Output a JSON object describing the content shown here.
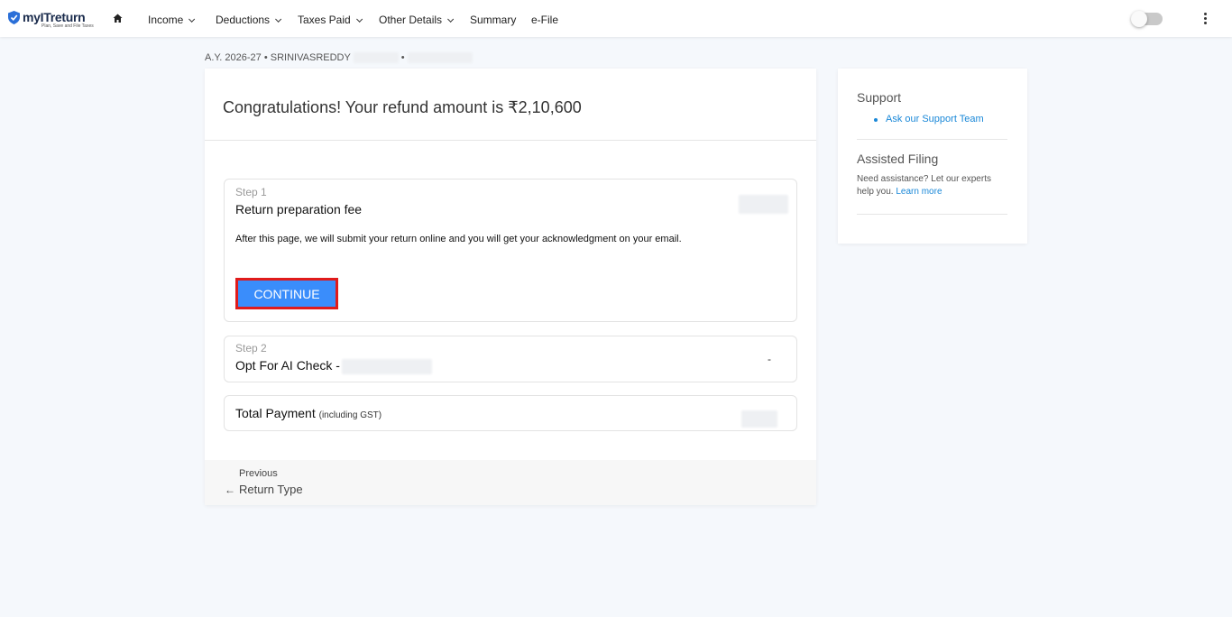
{
  "brand": {
    "name": "myITreturn",
    "tagline": "Plan, Save and File Taxes"
  },
  "nav": {
    "items": [
      {
        "label": "Income",
        "has_dropdown": true
      },
      {
        "label": "Deductions",
        "has_dropdown": true
      },
      {
        "label": "Taxes Paid",
        "has_dropdown": true
      },
      {
        "label": "Other Details",
        "has_dropdown": true
      },
      {
        "label": "Summary",
        "has_dropdown": false
      },
      {
        "label": "e-File",
        "has_dropdown": false
      }
    ],
    "toggle_on": false
  },
  "breadcrumb": {
    "assessment_year": "A.Y. 2026-27",
    "separator": "•",
    "name": "SRINIVASREDDY",
    "separator2": "•"
  },
  "main": {
    "heading": "Congratulations! Your refund amount is ₹2,10,600",
    "step1": {
      "label": "Step 1",
      "title": "Return preparation fee",
      "note": "After this page, we will submit your return online and you will get your acknowledgment on your email.",
      "button": "CONTINUE"
    },
    "step2": {
      "label": "Step 2",
      "title": "Opt For AI Check -",
      "value": "-"
    },
    "total": {
      "label": "Total Payment",
      "suffix": "(including GST)"
    },
    "footer": {
      "previous_label": "Previous",
      "previous_link": "Return Type",
      "arrow": "←"
    }
  },
  "sidebar": {
    "support_heading": "Support",
    "support_link": "Ask our Support Team",
    "assisted_heading": "Assisted Filing",
    "assisted_text": "Need assistance? Let our experts help you.",
    "learn_more": "Learn more"
  },
  "colors": {
    "accent": "#3a8dfb",
    "highlight_border": "#e01b1b",
    "link": "#1a88d8",
    "background": "#f5f8fc"
  }
}
